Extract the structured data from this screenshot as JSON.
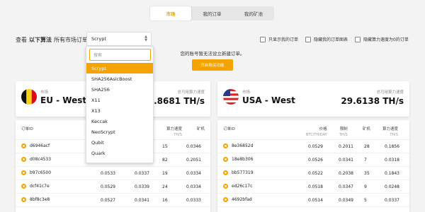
{
  "tabs": [
    {
      "label": "市场"
    },
    {
      "label": "我的订单"
    },
    {
      "label": "我的矿池"
    }
  ],
  "filter": {
    "prefix": "查看",
    "middle": "以下算法",
    "suffix": "所有市场订单",
    "selected": "Scrypt"
  },
  "checkboxes": [
    {
      "label": "只显示我的订单"
    },
    {
      "label": "隐藏我的订单图表"
    },
    {
      "label": "隐藏算力速度为0的订单"
    }
  ],
  "notice": "您的账号暂无法设立新建订单。",
  "cta_label": "开启购买功能",
  "dropdown": {
    "search_placeholder": "搜索",
    "options": [
      "Scrypt",
      "SHA256AsicBoost",
      "SHA256",
      "X11",
      "X13",
      "Keccak",
      "NeoScrypt",
      "Qubit",
      "Quark"
    ]
  },
  "markets": [
    {
      "label": "市场",
      "name": "EU - West",
      "speed_label": "总可用算力速度",
      "speed": "48.8681 TH/s"
    },
    {
      "label": "市场",
      "name": "USA - West",
      "speed_label": "总可用算力速度",
      "speed": "29.6138 TH/s"
    }
  ],
  "table_headers": {
    "id": "订单ID",
    "price": "价格",
    "price_unit": "BTC/TH/DAY",
    "limit": "限制",
    "limit_unit": "TH/S",
    "miners": "矿机",
    "speed": "算力速度",
    "speed_unit": "TH/S"
  },
  "left_rows": [
    {
      "id": "d6946acf",
      "price": "",
      "limit": "",
      "miners": "15",
      "speed": "0.0346"
    },
    {
      "id": "d08c4533",
      "price": "",
      "limit": "",
      "miners": "82",
      "speed": "0.2051"
    },
    {
      "id": "b97c6500",
      "price": "0.0533",
      "limit": "0.0337",
      "miners": "19",
      "speed": "0.0334"
    },
    {
      "id": "dcf41c7e",
      "price": "0.0529",
      "limit": "0.0339",
      "miners": "24",
      "speed": "0.0334"
    },
    {
      "id": "8bf8c3e8",
      "price": "0.0527",
      "limit": "0.0341",
      "miners": "16",
      "speed": "0.0333"
    }
  ],
  "right_rows": [
    {
      "id": "8e36852d",
      "price": "0.0529",
      "limit": "0.2011",
      "miners": "28",
      "speed": "0.1856"
    },
    {
      "id": "18e8b306",
      "price": "0.0526",
      "limit": "0.0341",
      "miners": "7",
      "speed": "0.0318"
    },
    {
      "id": "bb577319",
      "price": "0.0522",
      "limit": "0.2038",
      "miners": "35",
      "speed": "0.1843"
    },
    {
      "id": "ed26c17c",
      "price": "0.0518",
      "limit": "0.0347",
      "miners": "9",
      "speed": "0.0248"
    },
    {
      "id": "4692bfad",
      "price": "0.0514",
      "limit": "0.0349",
      "miners": "5",
      "speed": "0.0337"
    }
  ],
  "colors": {
    "accent": "#f4a300"
  }
}
